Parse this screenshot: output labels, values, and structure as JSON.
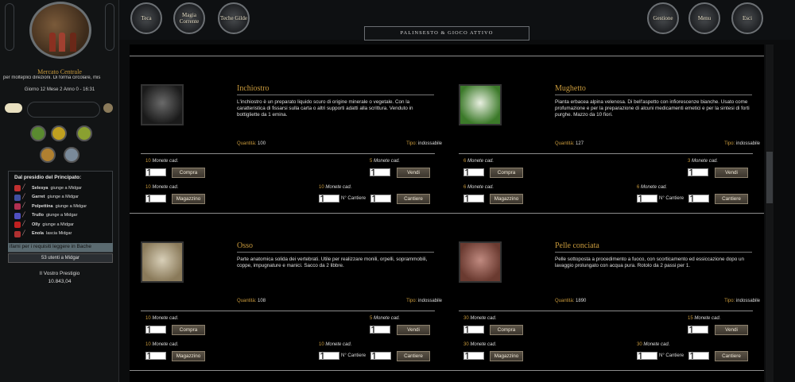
{
  "location": {
    "name": "Mercato Centrale",
    "description": "per molteplici direzioni. Di forma circolare, mis",
    "date": "Giorno 12 Mese 2 Anno 0 - 16:31"
  },
  "presidio": {
    "title": "Dal presidio del Principato:",
    "rows": [
      {
        "name": "Selesya",
        "action": "giunge a Midgar",
        "color": "#c03030"
      },
      {
        "name": "Garret",
        "action": "giunge a Midgar",
        "color": "#4050a0"
      },
      {
        "name": "Polpettina",
        "action": "giunge a Midgar",
        "color": "#b03050"
      },
      {
        "name": "Trullo",
        "action": "giunge a Midgar",
        "color": "#5050c0"
      },
      {
        "name": "Olly",
        "action": "giunge a Midgar",
        "color": "#c02020"
      },
      {
        "name": "Enola",
        "action": "lascia Midgar",
        "color": "#b03030"
      }
    ],
    "notice": "ifami per i requisiti leggere in Bache",
    "online": "53 utenti a Midgar"
  },
  "prestige": {
    "label": "Il Vostro Prestigio",
    "value": "10.843,04"
  },
  "topnav": {
    "teca": "Teca",
    "magia": "Magia Corrente",
    "gilde": "Teche Gilde",
    "gestione": "Gestione",
    "menu": "Menu",
    "esci": "Esci"
  },
  "palinsesto": "PALINSESTO & GIOCO ATTIVO",
  "labels": {
    "quantita": "Quantità:",
    "tipo": "Tipo:",
    "monete": "Monete cad.",
    "compra": "Compra",
    "vendi": "Vendi",
    "magazzino": "Magazzino",
    "cantiere": "Cantiere",
    "n_cantiere": "N° Cantiere"
  },
  "items": [
    {
      "title": "Inchiostro",
      "description": "L'inchiostro è un preparato liquido scuro di origine minerale o vegetale. Con la caratteristica di fissarsi sulla carta o altri supporti adatti alla scrittura. Venduto in bottigliette da 1 emina.",
      "quantity": "100",
      "tipo": "indossabile",
      "buy": "10",
      "sell": "5",
      "magazzino": "10",
      "cantiere": "10",
      "buy_qty": "1",
      "sell_qty": "1",
      "mag_qty": "1",
      "cant_qty": "1",
      "cant_n": "1",
      "thumb_colors": [
        "#6a6a6a",
        "#1a1a1a"
      ]
    },
    {
      "title": "Mughetto",
      "description": "Pianta erbacea alpina velenosa. Di bell'aspetto con infiorescenze bianche. Usato come profumazione e per la preparazione di alcuni medicamenti emetici e per la sintesi di forti purghe. Mazzo da 10 fiori.",
      "quantity": "127",
      "tipo": "indossabile",
      "buy": "6",
      "sell": "3",
      "magazzino": "6",
      "cantiere": "6",
      "buy_qty": "1",
      "sell_qty": "1",
      "mag_qty": "1",
      "cant_qty": "1",
      "cant_n": "1",
      "thumb_colors": [
        "#e8efe0",
        "#3c7a2a"
      ]
    },
    {
      "title": "Osso",
      "description": "Parte anatomica solida dei vertebrati. Utile per realizzare monili, orpelli, soprammobili, coppe, impugnature e manici. Sacco da 2 libbre.",
      "quantity": "108",
      "tipo": "indossabile",
      "buy": "10",
      "sell": "5",
      "magazzino": "10",
      "cantiere": "10",
      "buy_qty": "1",
      "sell_qty": "1",
      "mag_qty": "1",
      "cant_qty": "1",
      "cant_n": "1",
      "thumb_colors": [
        "#d8cfb8",
        "#8a7a5a"
      ]
    },
    {
      "title": "Pelle conciata",
      "description": "Pelle sottoposta a procedimento a fuoco, con scorticamento ed essiccazione dopo un lavaggio prolungato con acqua pura. Rotolo da 2 passi per 1.",
      "quantity": "1890",
      "tipo": "indossabile",
      "buy": "30",
      "sell": "15",
      "magazzino": "30",
      "cantiere": "30",
      "buy_qty": "1",
      "sell_qty": "1",
      "mag_qty": "1",
      "cant_qty": "1",
      "cant_n": "1",
      "thumb_colors": [
        "#c08a80",
        "#6a3a30"
      ]
    }
  ]
}
